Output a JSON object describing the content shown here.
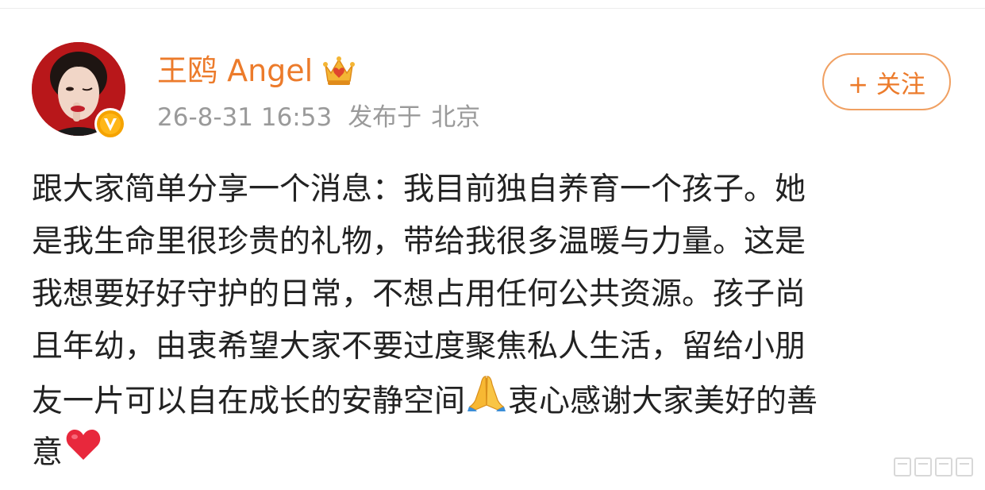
{
  "post": {
    "author": "王鸥 Angel",
    "time": "26-8-31 16:53",
    "location_prefix": "发布于",
    "location": "北京",
    "follow_label": "+ 关注",
    "lines": [
      "跟大家简单分享一个消息：我目前独自养育一个孩子。她",
      "是我生命里很珍贵的礼物，带给我很多温暖与力量。这是",
      "我想要好好守护的日常，不想占用任何公共资源。孩子尚",
      "且年幼，由衷希望大家不要过度聚焦私人生活，留给小朋",
      "友一片可以自在成长的安静空间",
      "衷心感谢大家美好的善",
      "意"
    ]
  },
  "icons": {
    "avatar": "avatar-photo",
    "verified": "verified-v-badge-icon",
    "crown": "crown-membership-icon",
    "pray": "folded-hands-emoji",
    "heart": "red-heart-emoji"
  },
  "colors": {
    "accent": "#ec7b2b",
    "meta": "#9a9a9a",
    "text": "#222222",
    "badge": "#f5a300"
  }
}
